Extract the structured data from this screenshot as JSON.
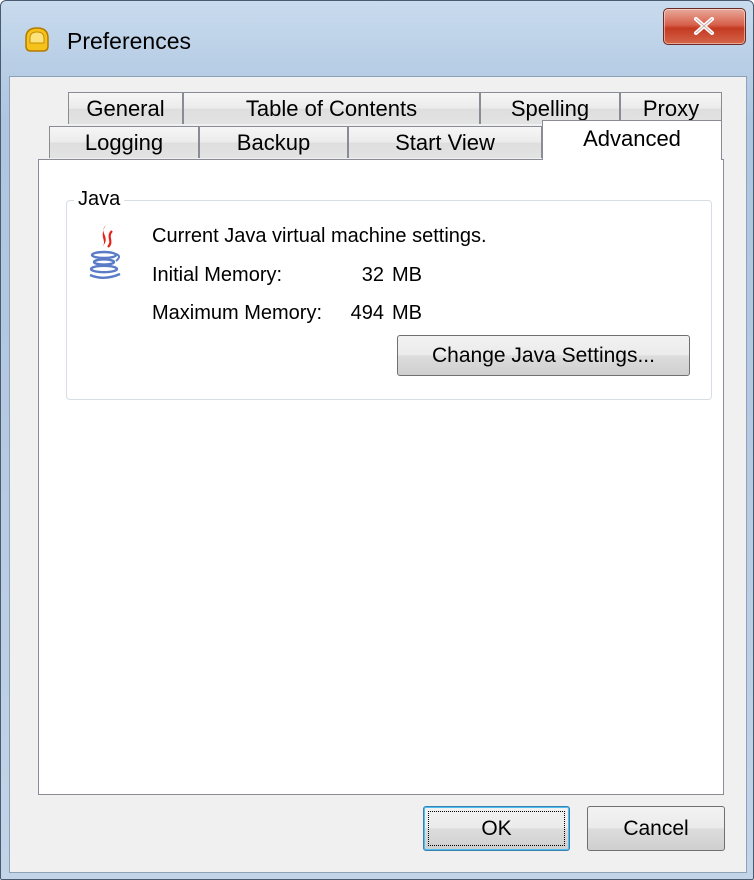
{
  "window": {
    "title": "Preferences",
    "close_glyph": "X"
  },
  "tabs": {
    "row_back": [
      {
        "label": "General"
      },
      {
        "label": "Table of Contents"
      },
      {
        "label": "Spelling"
      },
      {
        "label": "Proxy"
      }
    ],
    "row_front": [
      {
        "label": "Logging"
      },
      {
        "label": "Backup"
      },
      {
        "label": "Start View"
      },
      {
        "label": "Advanced"
      }
    ],
    "active": "Advanced"
  },
  "java_group": {
    "title": "Java",
    "icon": "java-icon",
    "description": "Current Java virtual machine settings.",
    "initial_memory_label": "Initial Memory:",
    "initial_memory_value": "32",
    "initial_memory_unit": "MB",
    "max_memory_label": "Maximum Memory:",
    "max_memory_value": "494",
    "max_memory_unit": "MB",
    "change_button": "Change Java Settings..."
  },
  "footer": {
    "ok": "OK",
    "cancel": "Cancel"
  },
  "colors": {
    "title_bar": "#b9cfe6",
    "close_button": "#c43a22",
    "dialog_bg": "#f0f0f0",
    "page_bg": "#ffffff"
  }
}
